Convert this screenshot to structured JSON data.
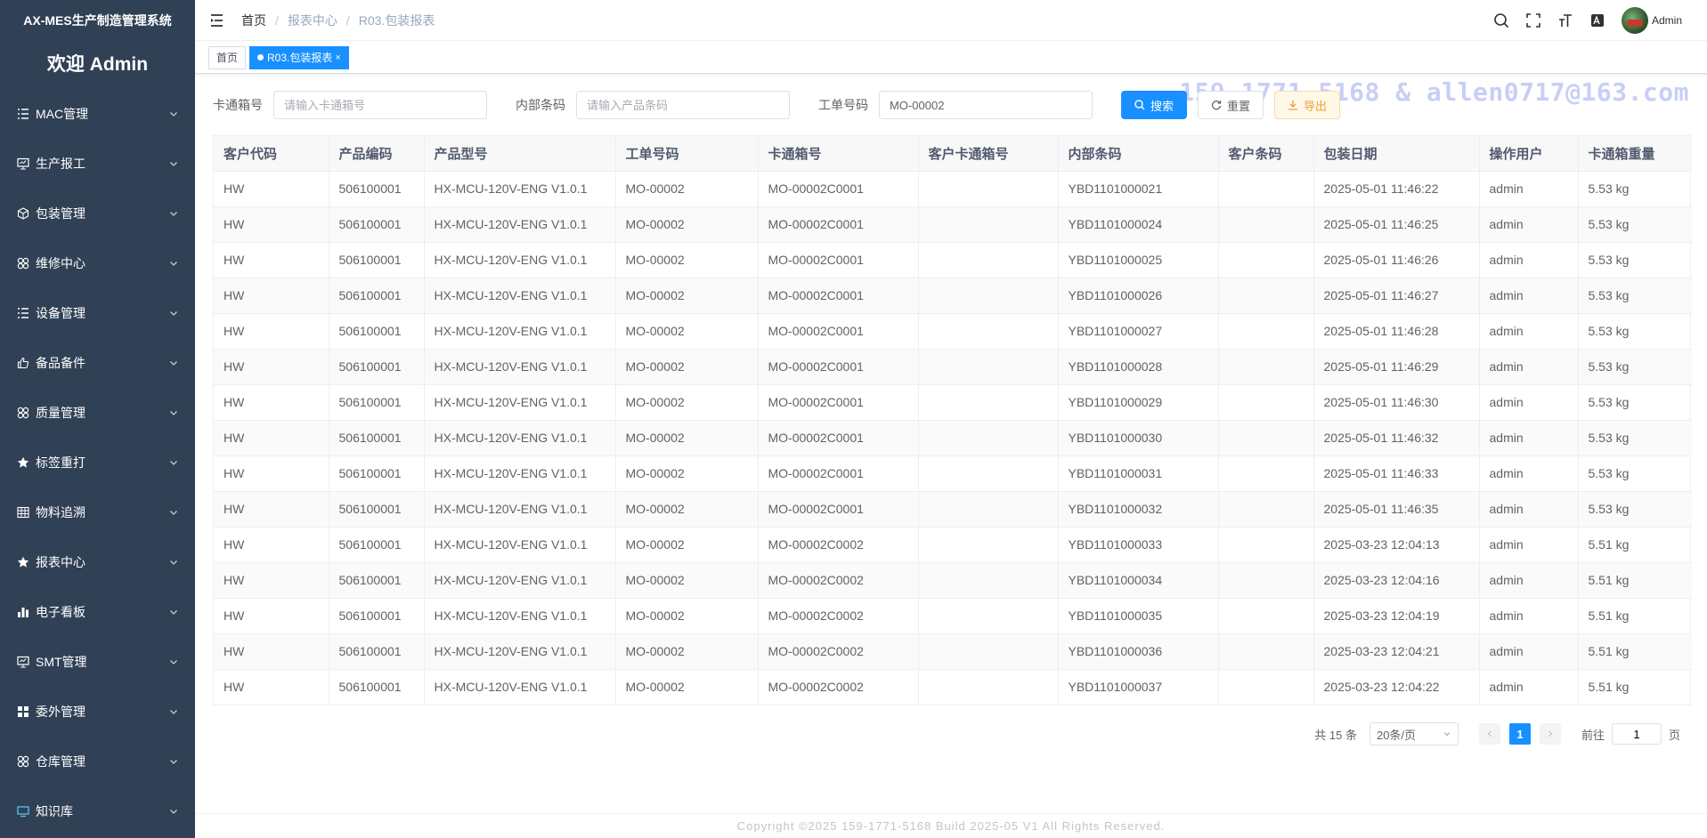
{
  "app": {
    "title": "AX-MES生产制造管理系统",
    "welcome": "欢迎 Admin"
  },
  "sidebar": {
    "items": [
      {
        "label": "MAC管理",
        "icon": "list-icon"
      },
      {
        "label": "生产报工",
        "icon": "monitor-icon"
      },
      {
        "label": "包装管理",
        "icon": "box-icon"
      },
      {
        "label": "维修中心",
        "icon": "component-icon"
      },
      {
        "label": "设备管理",
        "icon": "list-icon"
      },
      {
        "label": "备品备件",
        "icon": "thumbs-up-icon"
      },
      {
        "label": "质量管理",
        "icon": "component-icon"
      },
      {
        "label": "标签重打",
        "icon": "star-icon"
      },
      {
        "label": "物料追溯",
        "icon": "table-icon"
      },
      {
        "label": "报表中心",
        "icon": "star-icon"
      },
      {
        "label": "电子看板",
        "icon": "bar-chart-icon"
      },
      {
        "label": "SMT管理",
        "icon": "monitor-icon"
      },
      {
        "label": "委外管理",
        "icon": "grid-icon"
      },
      {
        "label": "仓库管理",
        "icon": "component-icon"
      },
      {
        "label": "知识库",
        "icon": "screen-icon"
      }
    ]
  },
  "header": {
    "breadcrumb": [
      "首页",
      "报表中心",
      "R03.包装报表"
    ],
    "user_name": "Admin"
  },
  "tags": {
    "home": "首页",
    "active": "R03.包装报表",
    "close": "×"
  },
  "watermark": "159-1771-5168 & allen0717@163.com",
  "search": {
    "carton_label": "卡通箱号",
    "carton_placeholder": "请输入卡通箱号",
    "carton_value": "",
    "barcode_label": "内部条码",
    "barcode_placeholder": "请输入产品条码",
    "barcode_value": "",
    "order_label": "工单号码",
    "order_value": "MO-00002",
    "search_btn": "搜索",
    "reset_btn": "重置",
    "export_btn": "导出"
  },
  "table": {
    "columns": [
      "客户代码",
      "产品编码",
      "产品型号",
      "工单号码",
      "卡通箱号",
      "客户卡通箱号",
      "内部条码",
      "客户条码",
      "包装日期",
      "操作用户",
      "卡通箱重量"
    ],
    "rows": [
      [
        "HW",
        "506100001",
        "HX-MCU-120V-ENG V1.0.1",
        "MO-00002",
        "MO-00002C0001",
        "",
        "YBD1101000021",
        "",
        "2025-05-01 11:46:22",
        "admin",
        "5.53 kg"
      ],
      [
        "HW",
        "506100001",
        "HX-MCU-120V-ENG V1.0.1",
        "MO-00002",
        "MO-00002C0001",
        "",
        "YBD1101000024",
        "",
        "2025-05-01 11:46:25",
        "admin",
        "5.53 kg"
      ],
      [
        "HW",
        "506100001",
        "HX-MCU-120V-ENG V1.0.1",
        "MO-00002",
        "MO-00002C0001",
        "",
        "YBD1101000025",
        "",
        "2025-05-01 11:46:26",
        "admin",
        "5.53 kg"
      ],
      [
        "HW",
        "506100001",
        "HX-MCU-120V-ENG V1.0.1",
        "MO-00002",
        "MO-00002C0001",
        "",
        "YBD1101000026",
        "",
        "2025-05-01 11:46:27",
        "admin",
        "5.53 kg"
      ],
      [
        "HW",
        "506100001",
        "HX-MCU-120V-ENG V1.0.1",
        "MO-00002",
        "MO-00002C0001",
        "",
        "YBD1101000027",
        "",
        "2025-05-01 11:46:28",
        "admin",
        "5.53 kg"
      ],
      [
        "HW",
        "506100001",
        "HX-MCU-120V-ENG V1.0.1",
        "MO-00002",
        "MO-00002C0001",
        "",
        "YBD1101000028",
        "",
        "2025-05-01 11:46:29",
        "admin",
        "5.53 kg"
      ],
      [
        "HW",
        "506100001",
        "HX-MCU-120V-ENG V1.0.1",
        "MO-00002",
        "MO-00002C0001",
        "",
        "YBD1101000029",
        "",
        "2025-05-01 11:46:30",
        "admin",
        "5.53 kg"
      ],
      [
        "HW",
        "506100001",
        "HX-MCU-120V-ENG V1.0.1",
        "MO-00002",
        "MO-00002C0001",
        "",
        "YBD1101000030",
        "",
        "2025-05-01 11:46:32",
        "admin",
        "5.53 kg"
      ],
      [
        "HW",
        "506100001",
        "HX-MCU-120V-ENG V1.0.1",
        "MO-00002",
        "MO-00002C0001",
        "",
        "YBD1101000031",
        "",
        "2025-05-01 11:46:33",
        "admin",
        "5.53 kg"
      ],
      [
        "HW",
        "506100001",
        "HX-MCU-120V-ENG V1.0.1",
        "MO-00002",
        "MO-00002C0001",
        "",
        "YBD1101000032",
        "",
        "2025-05-01 11:46:35",
        "admin",
        "5.53 kg"
      ],
      [
        "HW",
        "506100001",
        "HX-MCU-120V-ENG V1.0.1",
        "MO-00002",
        "MO-00002C0002",
        "",
        "YBD1101000033",
        "",
        "2025-03-23 12:04:13",
        "admin",
        "5.51 kg"
      ],
      [
        "HW",
        "506100001",
        "HX-MCU-120V-ENG V1.0.1",
        "MO-00002",
        "MO-00002C0002",
        "",
        "YBD1101000034",
        "",
        "2025-03-23 12:04:16",
        "admin",
        "5.51 kg"
      ],
      [
        "HW",
        "506100001",
        "HX-MCU-120V-ENG V1.0.1",
        "MO-00002",
        "MO-00002C0002",
        "",
        "YBD1101000035",
        "",
        "2025-03-23 12:04:19",
        "admin",
        "5.51 kg"
      ],
      [
        "HW",
        "506100001",
        "HX-MCU-120V-ENG V1.0.1",
        "MO-00002",
        "MO-00002C0002",
        "",
        "YBD1101000036",
        "",
        "2025-03-23 12:04:21",
        "admin",
        "5.51 kg"
      ],
      [
        "HW",
        "506100001",
        "HX-MCU-120V-ENG V1.0.1",
        "MO-00002",
        "MO-00002C0002",
        "",
        "YBD1101000037",
        "",
        "2025-03-23 12:04:22",
        "admin",
        "5.51 kg"
      ]
    ]
  },
  "pagination": {
    "total": "共 15 条",
    "page_size": "20条/页",
    "current_page": "1",
    "goto_label": "前往",
    "goto_value": "1",
    "page_unit": "页"
  },
  "footer": "Copyright ©2025 159-1771-5168 Build 2025-05 V1 All Rights Reserved.",
  "colors": {
    "sidebar_bg": "#304156",
    "primary": "#1890ff",
    "warning": "#e6a23c",
    "watermark": "#c8cef6"
  }
}
